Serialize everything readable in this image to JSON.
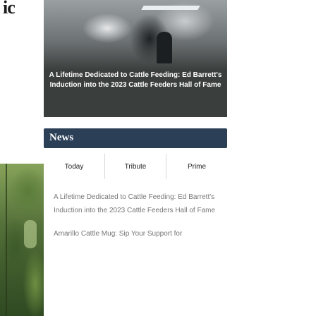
{
  "sidebar": {
    "logo_text": "ic"
  },
  "feature": {
    "caption": "A Lifetime Dedicated to Cattle Feeding: Ed Barrett's Induction into the 2023 Cattle Feeders Hall of Fame"
  },
  "news": {
    "title": "News",
    "tabs": [
      {
        "label": "Today"
      },
      {
        "label": "Tribute"
      },
      {
        "label": "Prime"
      }
    ],
    "articles": [
      {
        "headline": "A Lifetime Dedicated to Cattle Feeding: Ed Barrett's Induction into the 2023 Cattle Feeders Hall of Fame"
      },
      {
        "headline": "Amarillo Cattle Mug: Sip Your Support for"
      }
    ]
  },
  "colors": {
    "news_bar": "#2b3f57",
    "feature_overlay": "#3a3e3c"
  }
}
